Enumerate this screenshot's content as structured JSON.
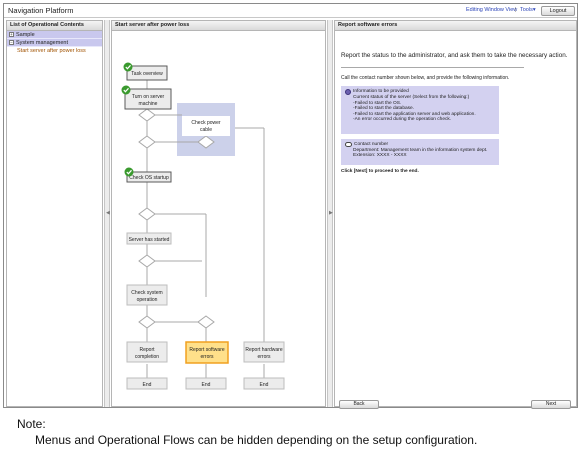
{
  "header": {
    "title": "Navigation Platform",
    "editing_window_view": "Editing Window View",
    "separator": "|",
    "tools": "Tools▾",
    "logout": "Logout"
  },
  "left_panel": {
    "title": "List of Operational Contents",
    "items": [
      {
        "toggle": "+",
        "label": "Sample"
      },
      {
        "toggle": "−",
        "label": "System management"
      }
    ],
    "active_child": "Start server after power loss"
  },
  "center_panel": {
    "title": "Start server after power loss",
    "nodes": {
      "task_overview": "Task overview",
      "turn_on_1": "Turn on server",
      "turn_on_2": "machine",
      "check_power_1": "Check power",
      "check_power_2": "cable",
      "check_os": "Check OS startup",
      "server_started": "Server has started",
      "check_sys_1": "Check system",
      "check_sys_2": "operation",
      "report_completion_1": "Report",
      "report_completion_2": "completion",
      "report_software_1": "Report software",
      "report_software_2": "errors",
      "report_hardware_1": "Report hardware",
      "report_hardware_2": "errors",
      "end": "End"
    }
  },
  "right_panel": {
    "title": "Report software errors",
    "main_text": "Report the status to the administrator, and ask them to take the necessary action.",
    "call_text": "Call the contact number shown below, and provide the following information.",
    "info_box": {
      "heading": "Information to be provided",
      "lines": [
        "Current status of the server (Select from the following:)",
        "-Failed to start the OS.",
        "-Failed to start the database.",
        "-Failed to start the application server and web application.",
        "-An error occurred during the operation check."
      ]
    },
    "contact_box": {
      "heading": "Contact number",
      "lines": [
        "Department: Management team in the information system dept.",
        "Extension: XXXX - XXXX"
      ]
    },
    "next_note": "Click [Next] to proceed to the end.",
    "back": "Back",
    "next": "Next"
  },
  "note": {
    "title": "Note:",
    "text": "Menus and Operational Flows can be hidden depending on the setup configuration."
  },
  "colors": {
    "tree_bg": "#c9c8ee",
    "highlight": "#a05200",
    "check_green": "#3a9a2e",
    "selected_node_border": "#f0a020",
    "selected_node_fill": "#ffe08a",
    "info_box": "#d3d1f0"
  }
}
